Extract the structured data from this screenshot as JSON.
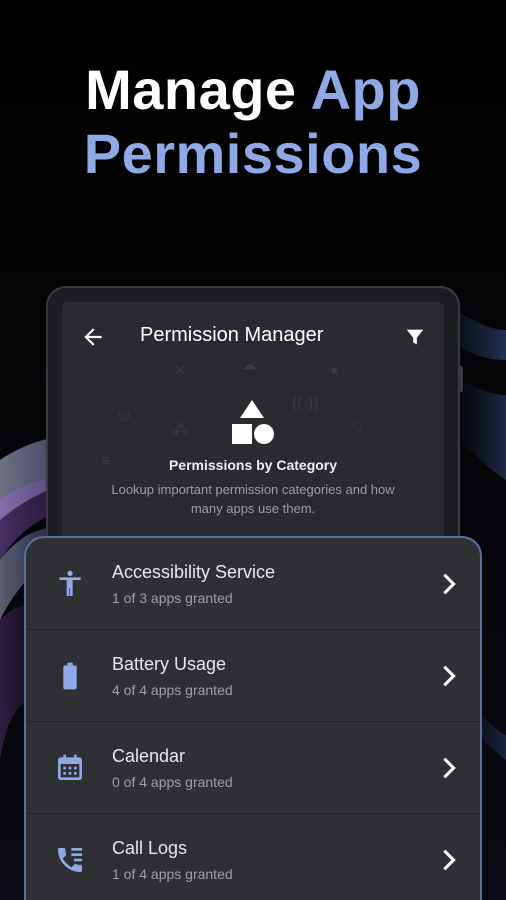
{
  "headline": {
    "line1_white": "Manage",
    "line1_accent": "App",
    "line2_accent": "Permissions"
  },
  "colors": {
    "background": "#000000",
    "accent": "#8fa8e6",
    "icon_blue": "#8fa8e6",
    "card_border": "#5c6e9c",
    "card_bg": "#2f3033",
    "tablet_screen": "#2a2b2e"
  },
  "app": {
    "title": "Permission Manager",
    "back_icon": "arrow-left-icon",
    "filter_icon": "filter-icon"
  },
  "hero": {
    "icon": "shapes-icon",
    "title": "Permissions by Category",
    "description": "Lookup important permission categories and how many apps use them."
  },
  "permissions": [
    {
      "label": "Accessibility Service",
      "sub": "1 of 3 apps granted",
      "icon": "accessibility-icon"
    },
    {
      "label": "Battery Usage",
      "sub": "4 of 4 apps granted",
      "icon": "battery-icon"
    },
    {
      "label": "Calendar",
      "sub": "0 of 4 apps granted",
      "icon": "calendar-icon"
    },
    {
      "label": "Call Logs",
      "sub": "1 of 4 apps granted",
      "icon": "call-log-icon"
    }
  ]
}
